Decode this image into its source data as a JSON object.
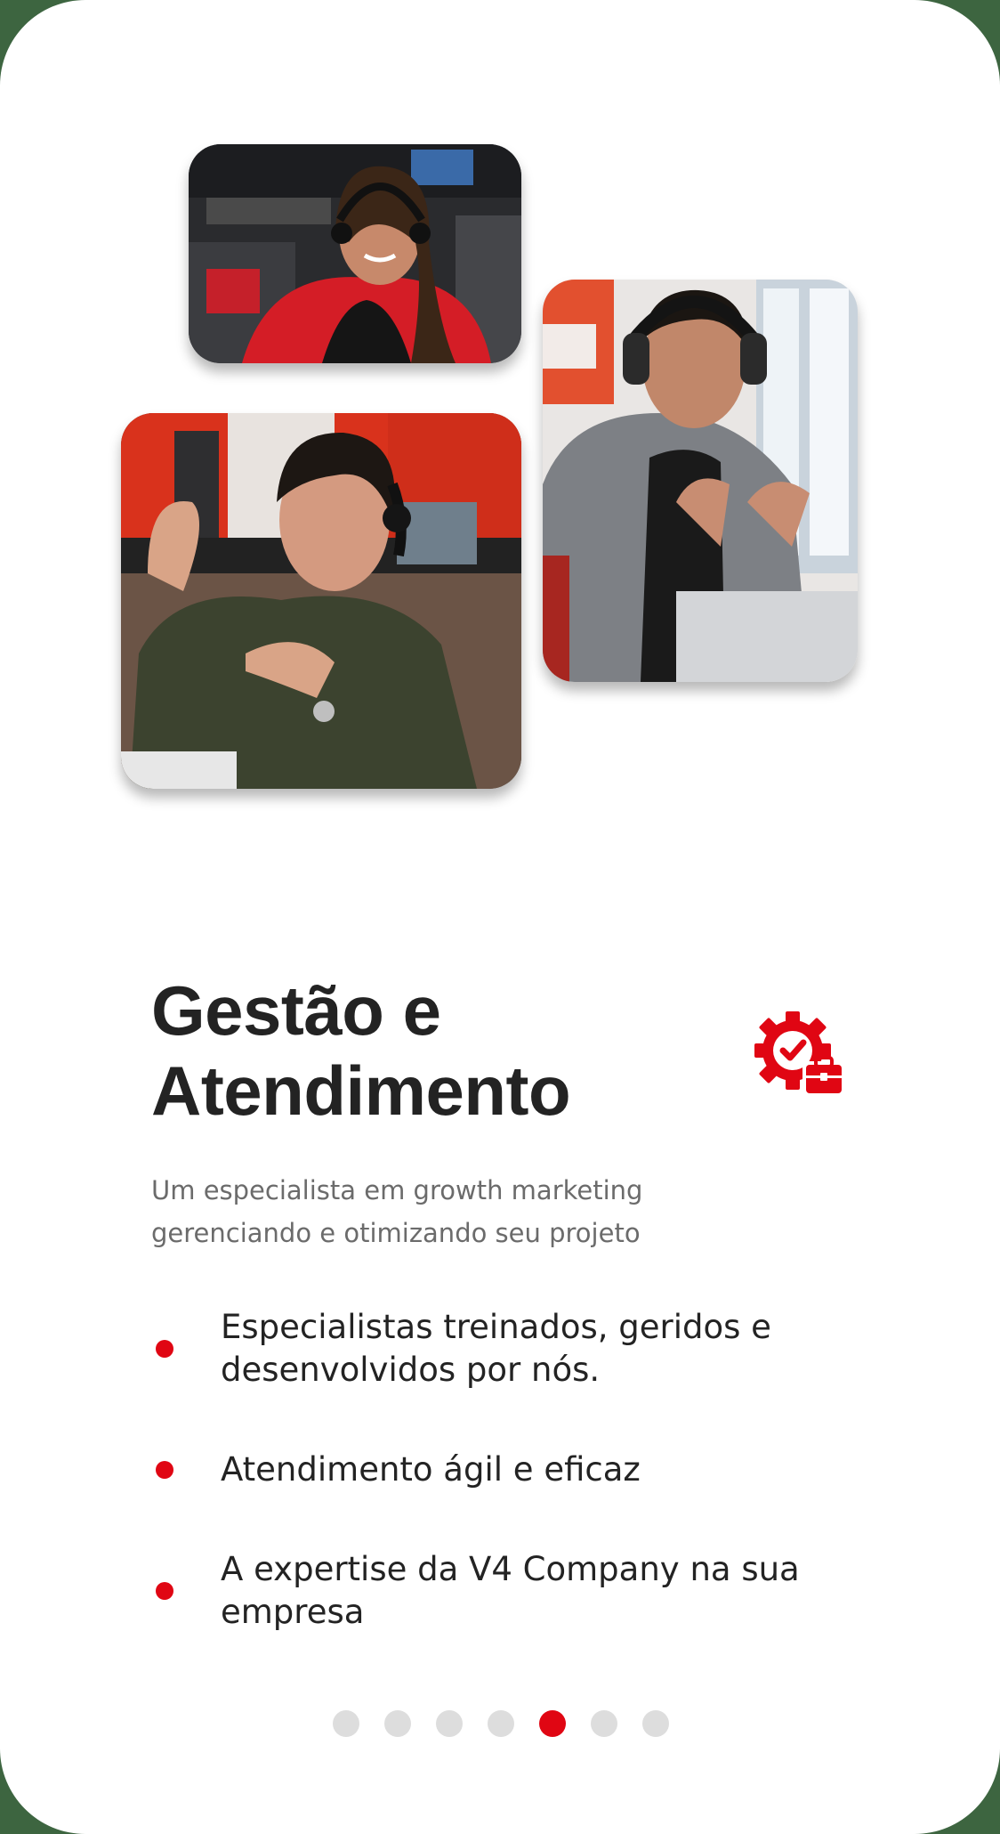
{
  "slide": {
    "title_line_1": "Gestão e",
    "title_line_2": "Atendimento",
    "title_icon": "gear-briefcase-check-icon",
    "subtitle": "Um especialista em growth marketing gerenciando e otimizando seu projeto",
    "features": [
      "Especialistas treinados, geridos e desenvolvidos por nós.",
      "Atendimento ágil e eficaz",
      "A expertise da V4 Company na sua empresa"
    ]
  },
  "photos": [
    {
      "subject": "woman-with-headset-photo"
    },
    {
      "subject": "man-in-gray-blazer-with-headset-photo"
    },
    {
      "subject": "man-in-green-shirt-with-headset-photo"
    }
  ],
  "pagination": {
    "total": 7,
    "active_index": 4
  },
  "colors": {
    "accent": "#e00613",
    "title": "#232323",
    "subtitle": "#6b6b6b",
    "dot_inactive": "#dddddd",
    "background": "#3d6540"
  }
}
